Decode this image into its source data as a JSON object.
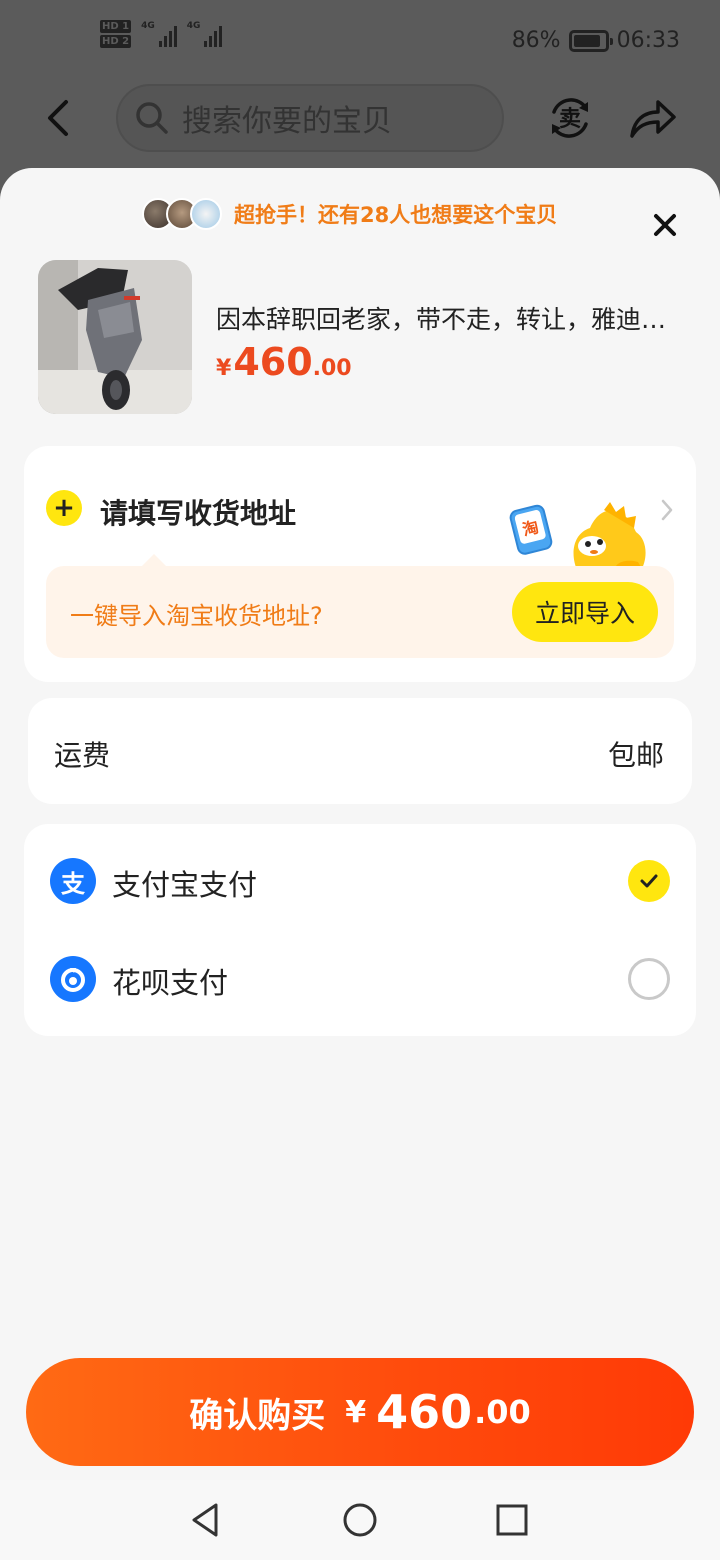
{
  "status_bar": {
    "hd1": "HD 1",
    "hd2": "HD 2",
    "net1": "4G",
    "net2": "4G",
    "battery_percent": "86%",
    "battery_level": 0.86,
    "time": "06:33"
  },
  "top_bar": {
    "search_placeholder": "搜索你要的宝贝",
    "sell_icon_char": "卖",
    "icons": [
      "back-arrow-icon",
      "search-icon",
      "sell-icon",
      "share-icon"
    ]
  },
  "sheet": {
    "social_proof": "超抢手！还有28人也想要这个宝贝",
    "product": {
      "title": "因本辞职回老家，带不走，转让，雅迪电动车",
      "price_currency": "¥",
      "price_integer": "460",
      "price_decimal": ".00"
    },
    "address": {
      "plus": "+",
      "title": "请填写收货地址",
      "mascot_badge": "淘",
      "import_prompt": "一键导入淘宝收货地址?",
      "import_button": "立即导入"
    },
    "shipping": {
      "label": "运费",
      "value": "包邮"
    },
    "payment": {
      "options": [
        {
          "icon_char": "支",
          "label": "支付宝支付",
          "selected": true
        },
        {
          "icon_char": "",
          "label": "花呗支付",
          "selected": false
        }
      ]
    },
    "confirm": {
      "label": "确认购买",
      "currency": "¥",
      "integer": "460",
      "decimal": ".00"
    }
  },
  "colors": {
    "accent_yellow": "#ffe60f",
    "price_orange": "#ec4a1f",
    "hint_orange": "#f07c17",
    "alipay_blue": "#1677ff",
    "confirm_gradient_start": "#ff6a14",
    "confirm_gradient_end": "#ff3a06"
  }
}
